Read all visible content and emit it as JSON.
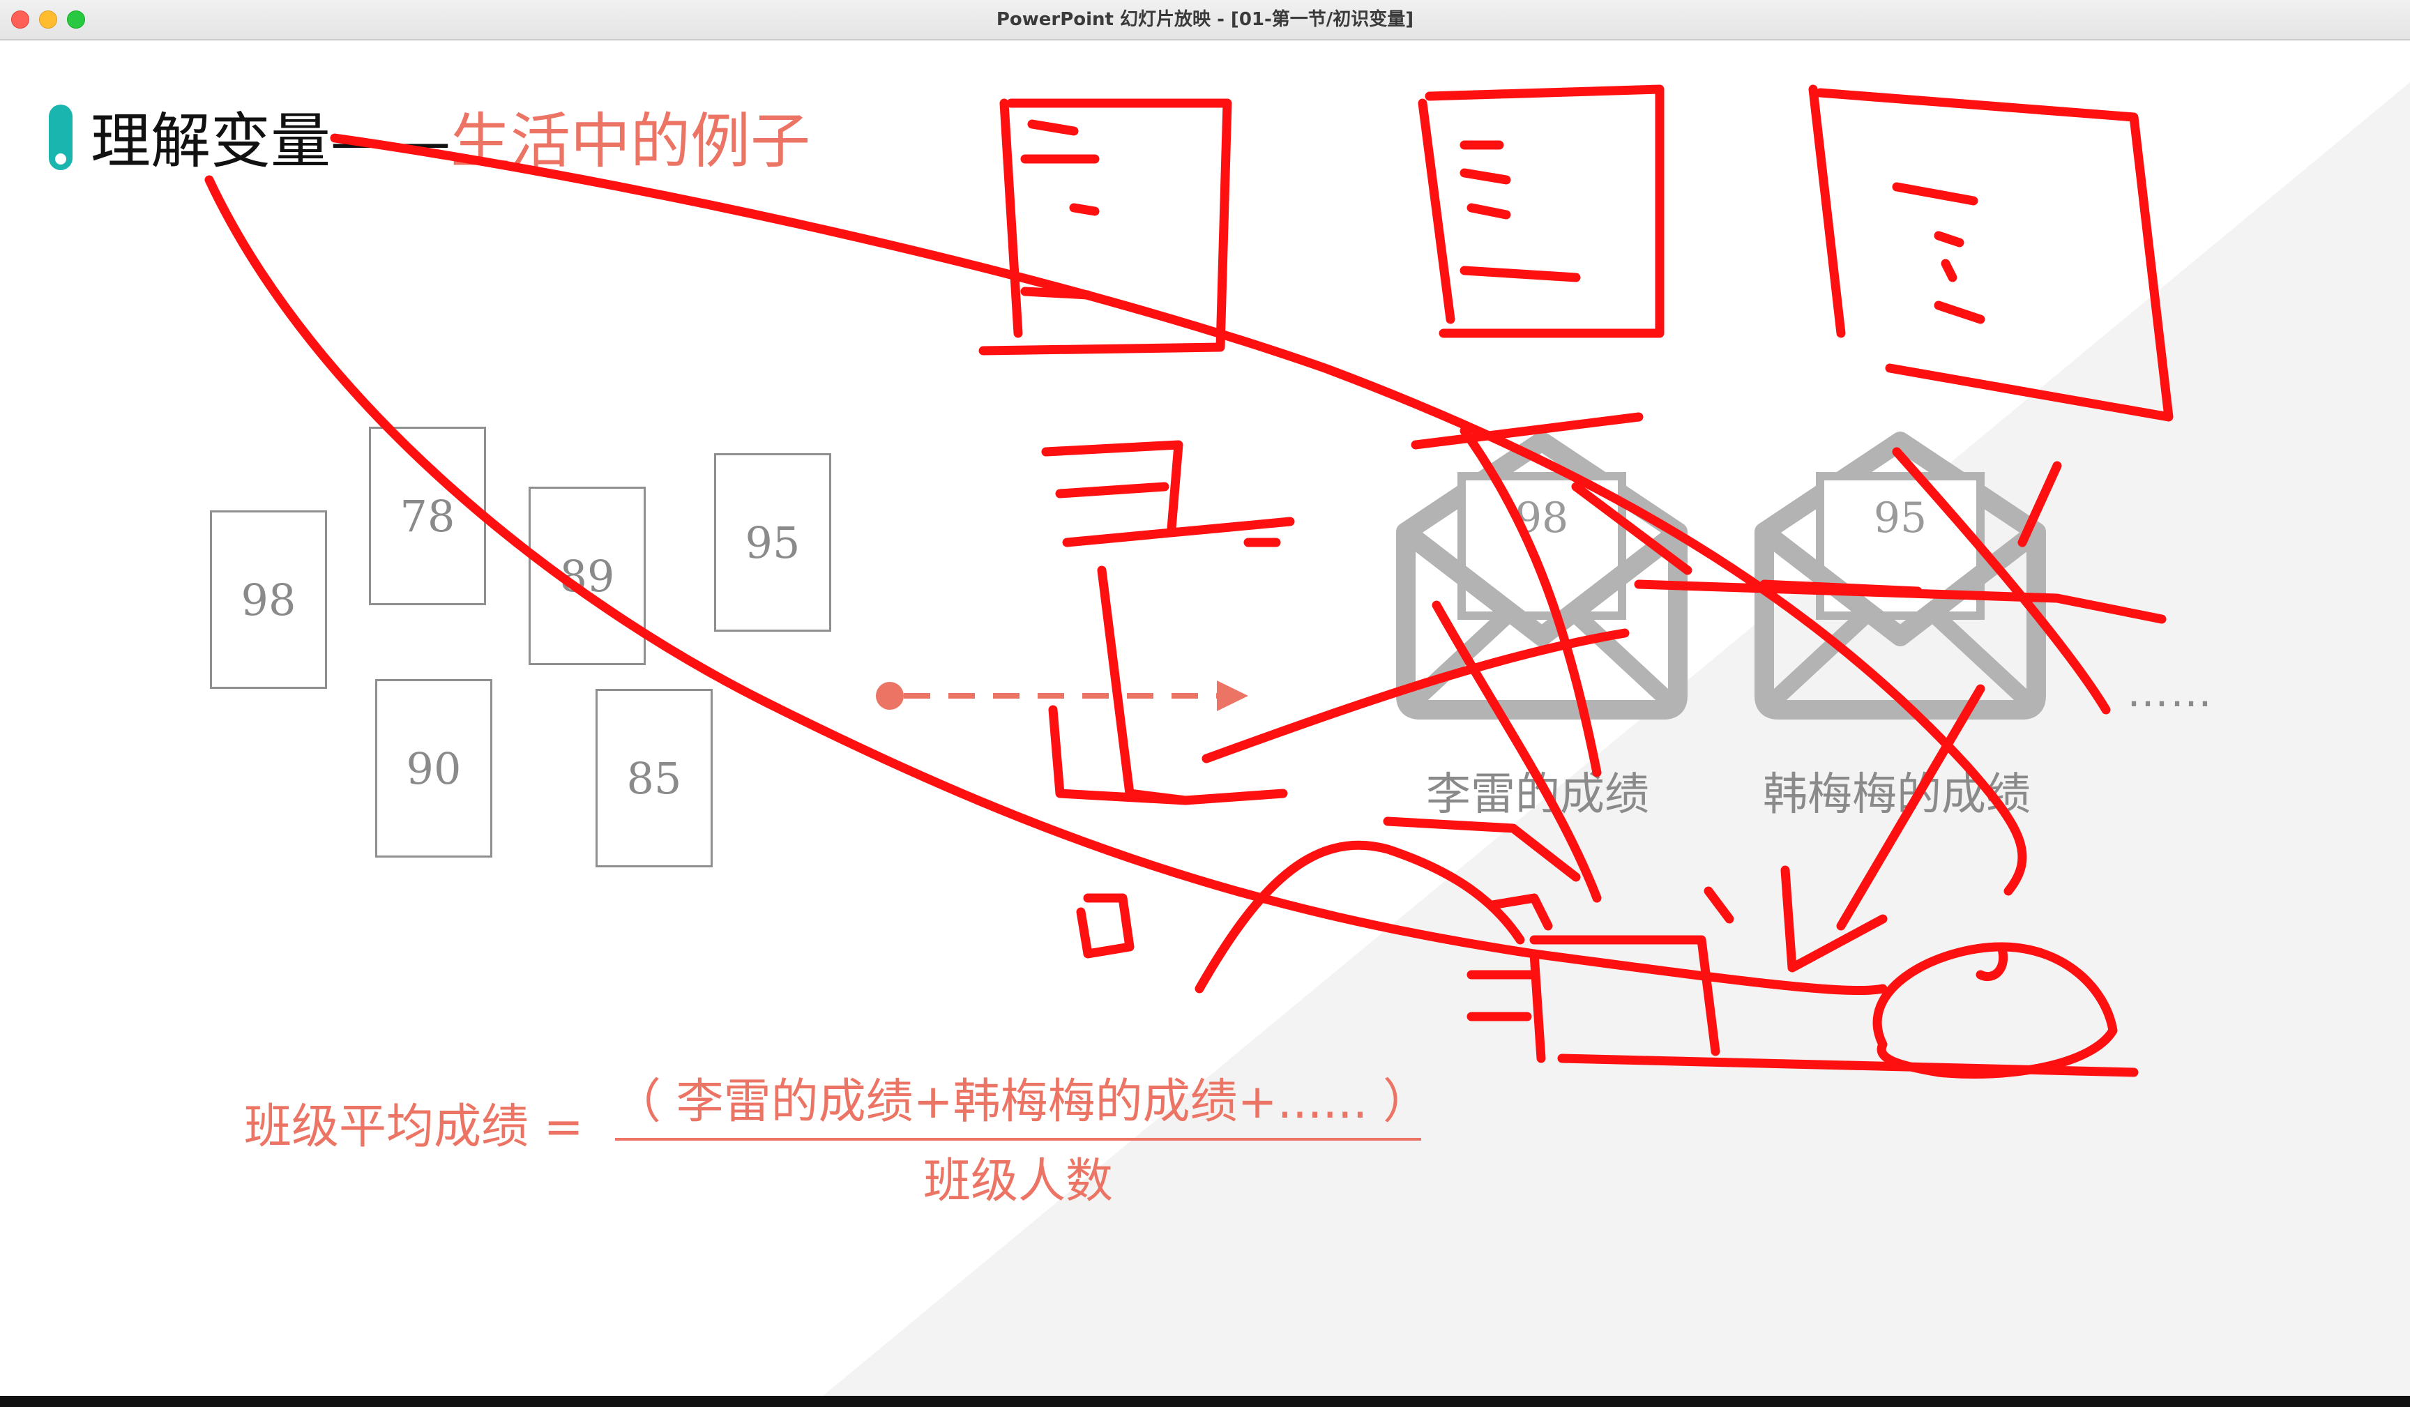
{
  "window": {
    "title": "PowerPoint 幻灯片放映 - [01-第一节/初识变量]"
  },
  "slide": {
    "heading": {
      "main": "理解变量",
      "dash": "——",
      "sub": "生活中的例子"
    },
    "cards": [
      "98",
      "78",
      "89",
      "95",
      "90",
      "85"
    ],
    "envelopes": [
      {
        "score": "98",
        "label": "李雷的成绩"
      },
      {
        "score": "95",
        "label": "韩梅梅的成绩"
      }
    ],
    "ellipsis": "……",
    "formula": {
      "left": "班级平均成绩 =",
      "numerator": "（ 李雷的成绩+韩梅梅的成绩+...... ）",
      "denominator": "班级人数"
    }
  },
  "colors": {
    "accent": "#ec7464",
    "marker": "#1bb5b0",
    "ink": "#ff0000",
    "card_border": "#8f8f8f",
    "envelope": "#b3b3b3"
  }
}
